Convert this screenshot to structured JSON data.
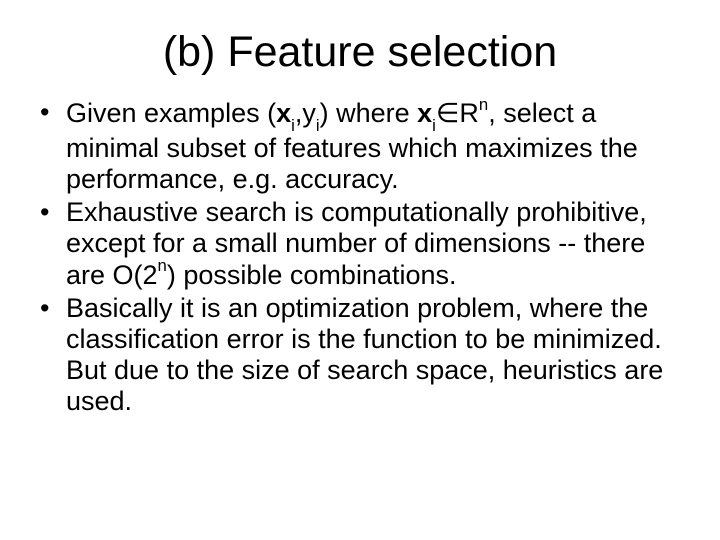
{
  "title": "(b) Feature selection",
  "bullets": [
    {
      "pre": "Given examples (",
      "x1": "x",
      "sub1": "i",
      "mid1": ",y",
      "sub2": "i",
      "mid2": ") where ",
      "x2": "x",
      "sub3": "i",
      "in": "∈R",
      "sup1": "n",
      "rest": ", select a minimal subset of features which maximizes the performance, e.g. accuracy."
    },
    {
      "pre": "Exhaustive search is computationally prohibitive, except for a small number of dimensions -- there are O(2",
      "sup": "n",
      "rest": ") possible combinations."
    },
    {
      "text": "Basically it is an optimization problem, where the classification error is the function to be minimized. But due to the size of search space, heuristics are used."
    }
  ]
}
